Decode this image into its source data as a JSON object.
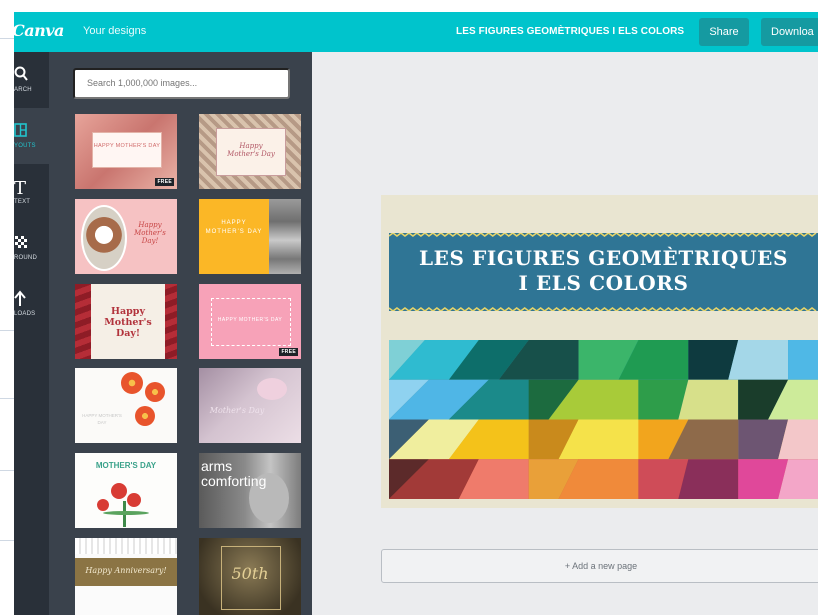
{
  "app": {
    "logo": "Canva",
    "nav_link": "Your designs",
    "document_title": "LES FIGURES GEOMÈTRIQUES I ELS COLORS",
    "share_label": "Share",
    "download_label": "Downloa",
    "accent": "#00c4cc"
  },
  "rail": {
    "search_label": "ARCH",
    "layouts_label": "YOUTS",
    "text_label": "TEXT",
    "background_label": "ROUND",
    "uploads_label": "LOADS"
  },
  "panel": {
    "search_placeholder": "Search 1,000,000 images...",
    "free_badge": "FREE",
    "thumbs": {
      "t1": "HAPPY MOTHER'S DAY",
      "t2": "Happy Mother's Day",
      "t3": "Happy Mother's Day!",
      "t4": "HAPPY MOTHER'S DAY",
      "t5": "Happy Mother's Day!",
      "t6": "HAPPY MOTHER'S DAY",
      "t7": "HAPPY MOTHER'S DAY",
      "t8": "Mother's Day",
      "t9": "MOTHER'S DAY",
      "t10": "arms comforting",
      "t11": "Happy Anniversary!",
      "t12": "50th"
    }
  },
  "design": {
    "title_line1": "LES FIGURES GEOMÈTRIQUES",
    "title_line2": "I ELS COLORS",
    "add_page_label": "+ Add a new page"
  }
}
